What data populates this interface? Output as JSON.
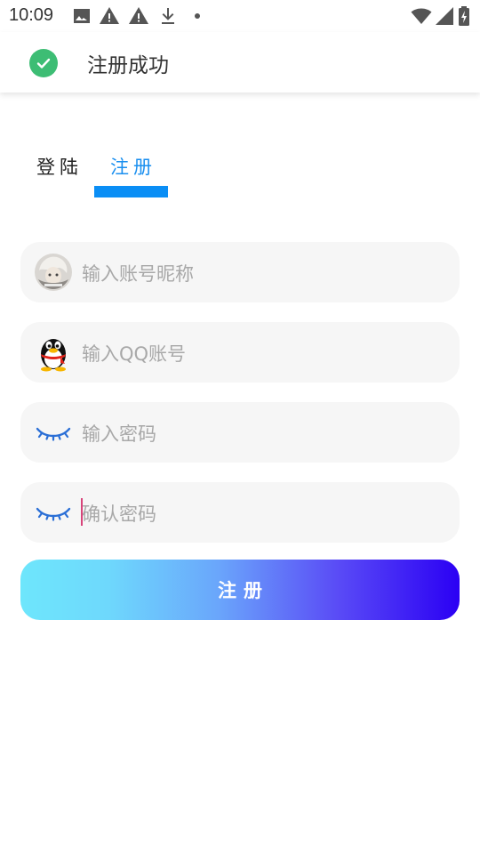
{
  "status_bar": {
    "time": "10:09",
    "icons_left": [
      "image-icon",
      "warning-icon",
      "warning-icon",
      "download-icon",
      "dot-icon"
    ],
    "icons_right": [
      "wifi-icon",
      "signal-icon",
      "battery-charging-icon"
    ]
  },
  "toast": {
    "icon": "check-circle-icon",
    "message": "注册成功",
    "icon_color": "#3dbd74"
  },
  "tabs": [
    {
      "label": "登陆",
      "active": false
    },
    {
      "label": "注册",
      "active": true
    }
  ],
  "accent_color": "#0a8ef5",
  "form": {
    "fields": [
      {
        "icon": "avatar-icon",
        "placeholder": "输入账号昵称"
      },
      {
        "icon": "qq-penguin-icon",
        "placeholder": "输入QQ账号"
      },
      {
        "icon": "eye-closed-icon",
        "placeholder": "输入密码"
      },
      {
        "icon": "eye-closed-icon",
        "placeholder": "确认密码",
        "focused": true
      }
    ],
    "submit_label": "注册"
  }
}
